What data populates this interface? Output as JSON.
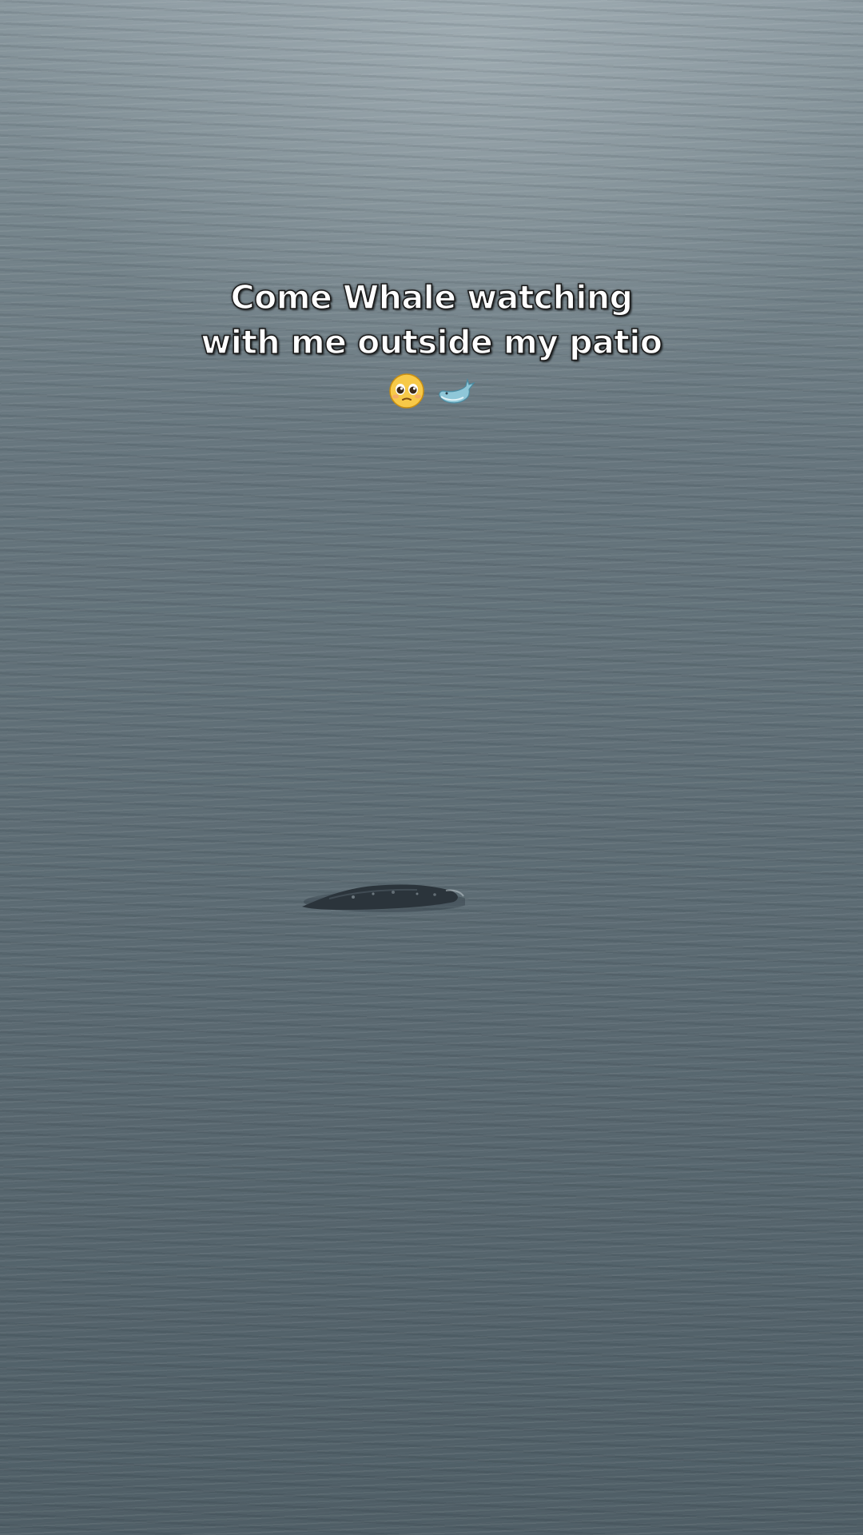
{
  "caption": {
    "line1": "Come Whale watching",
    "line2": "with me outside my patio"
  },
  "emojis": [
    "pleading-face-icon",
    "whale-icon"
  ],
  "colors": {
    "water": "#5d6c74",
    "caption_text": "#ffffff",
    "caption_outline": "#1a1a1a"
  }
}
